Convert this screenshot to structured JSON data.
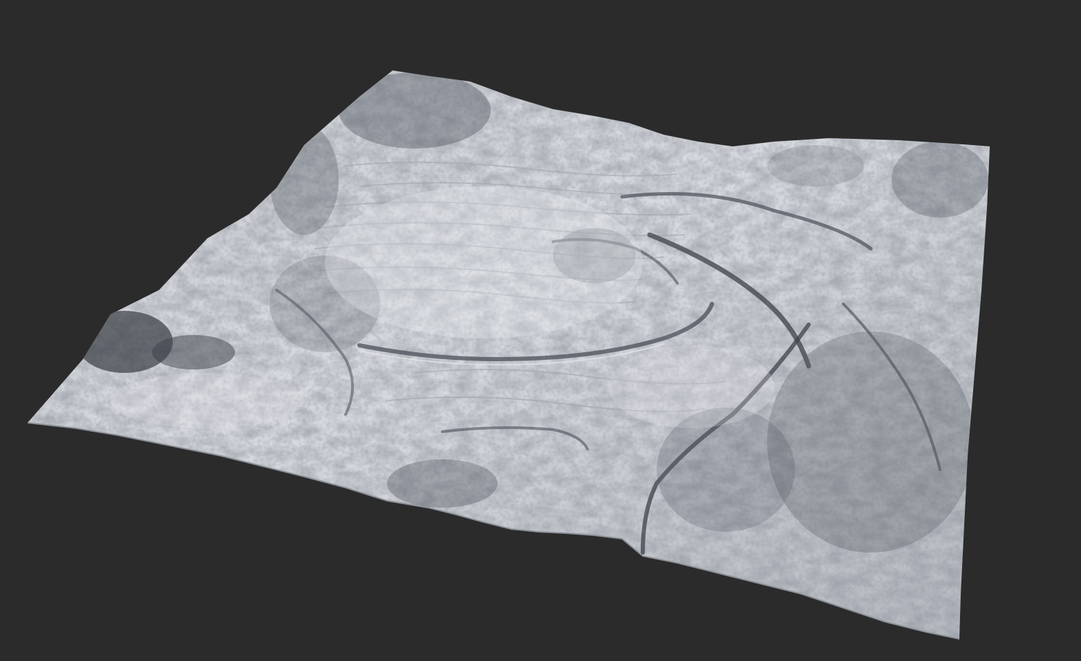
{
  "scene": {
    "background_color": "#2b2b2b",
    "terrain_base_color": "#b9bdc4",
    "terrain_highlight_color": "#dfe2e7",
    "terrain_shadow_color": "#4a4f58",
    "terrain_deep_shadow_color": "#2f333a"
  }
}
